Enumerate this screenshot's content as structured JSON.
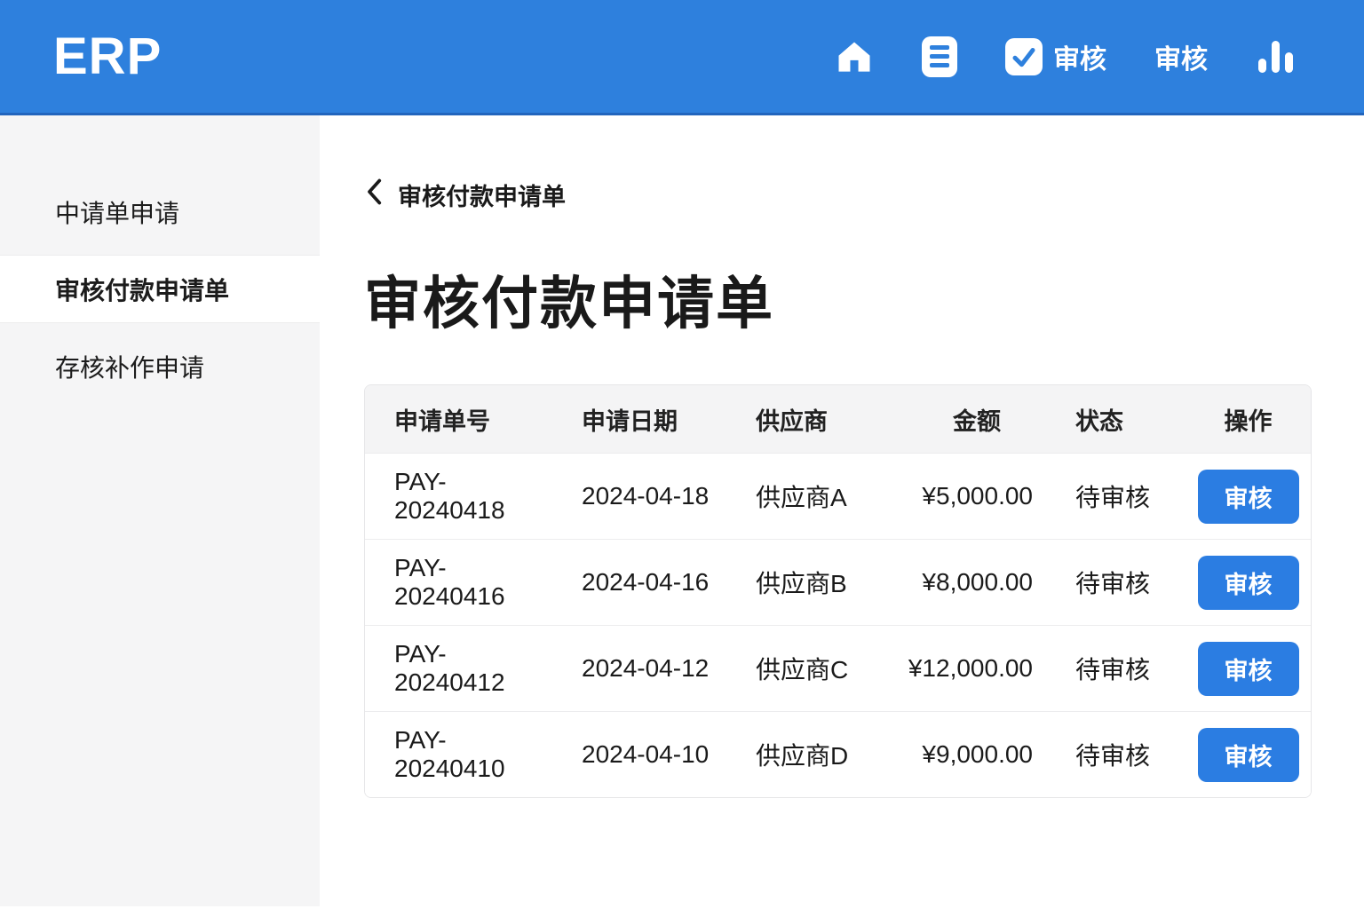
{
  "header": {
    "logo": "ERP",
    "nav": {
      "home": {
        "icon": "home-icon"
      },
      "documents": {
        "icon": "document-icon"
      },
      "audit_check": {
        "icon": "checkbox-checked-icon",
        "label": "审核"
      },
      "audit": {
        "label": "审核"
      },
      "stats": {
        "icon": "bar-chart-icon"
      }
    }
  },
  "sidebar": {
    "items": [
      {
        "label": "中请单申请",
        "active": false
      },
      {
        "label": "审核付款申请单",
        "active": true
      },
      {
        "label": "存核补作申请",
        "active": false
      }
    ]
  },
  "main": {
    "breadcrumb": {
      "icon": "chevron-left-icon",
      "label": "审核付款申请单"
    },
    "title": "审核付款申请单",
    "table": {
      "columns": [
        "申请单号",
        "申请日期",
        "供应商",
        "金额",
        "状态",
        "操作"
      ],
      "rows": [
        {
          "request_no": "PAY-20240418",
          "date": "2024-04-18",
          "supplier": "供应商A",
          "amount": "¥5,000.00",
          "status": "待审核",
          "action": "审核"
        },
        {
          "request_no": "PAY-20240416",
          "date": "2024-04-16",
          "supplier": "供应商B",
          "amount": "¥8,000.00",
          "status": "待审核",
          "action": "审核"
        },
        {
          "request_no": "PAY-20240412",
          "date": "2024-04-12",
          "supplier": "供应商C",
          "amount": "¥12,000.00",
          "status": "待审核",
          "action": "审核"
        },
        {
          "request_no": "PAY-20240410",
          "date": "2024-04-10",
          "supplier": "供应商D",
          "amount": "¥9,000.00",
          "status": "待审核",
          "action": "审核"
        }
      ]
    }
  },
  "colors": {
    "header_blue": "#2E80DD",
    "header_border": "#2265BD",
    "accent_button": "#2B7DE2",
    "sidebar_bg": "#F5F5F6",
    "table_header_bg": "#F4F4F5"
  }
}
